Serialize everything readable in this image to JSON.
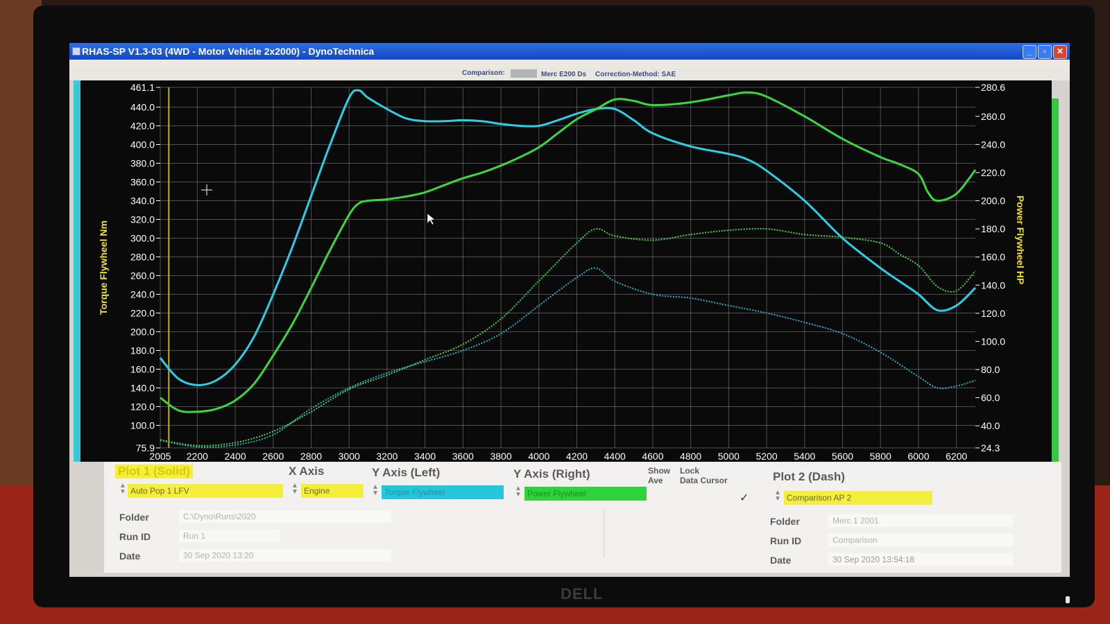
{
  "window": {
    "title": "RHAS-SP V1.3-03  (4WD - Motor Vehicle 2x2000) - DynoTechnica",
    "buttons": {
      "minimize": "_",
      "maximize": "▫",
      "close": "✕"
    }
  },
  "header": {
    "comparison_label": "Comparison:",
    "comparison_name": "Merc E200 Ds",
    "correction_method": "Correction-Method: SAE"
  },
  "chart_data": {
    "type": "line",
    "x_range": [
      2005,
      6300
    ],
    "x_ticks": [
      "2005",
      "2200",
      "2400",
      "2600",
      "2800",
      "3000",
      "3200",
      "3400",
      "3600",
      "3800",
      "4000",
      "4200",
      "4400",
      "4600",
      "4800",
      "5000",
      "5200",
      "5400",
      "5600",
      "5800",
      "6000",
      "6200"
    ],
    "y_left": {
      "label": "Torque Flywheel Nm",
      "range": [
        75.9,
        461.1
      ],
      "ticks": [
        "461.1",
        "440.0",
        "420.0",
        "400.0",
        "380.0",
        "360.0",
        "340.0",
        "320.0",
        "300.0",
        "280.0",
        "260.0",
        "240.0",
        "220.0",
        "200.0",
        "180.0",
        "160.0",
        "140.0",
        "120.0",
        "100.0",
        "75.9"
      ]
    },
    "y_right": {
      "label": "Power Flywheel HP",
      "range": [
        24.3,
        280.6
      ],
      "ticks": [
        "280.6",
        "260.0",
        "240.0",
        "220.0",
        "200.0",
        "180.0",
        "160.0",
        "140.0",
        "120.0",
        "100.0",
        "80.0",
        "60.0",
        "40.0",
        "24.3"
      ]
    },
    "grid": true,
    "series": [
      {
        "axis": "left",
        "color": "#2ad0e6",
        "style": "solid",
        "x": [
          2005,
          2100,
          2200,
          2300,
          2400,
          2500,
          2600,
          2700,
          2800,
          2900,
          3000,
          3050,
          3100,
          3200,
          3300,
          3400,
          3500,
          3600,
          3700,
          3800,
          3900,
          4000,
          4100,
          4200,
          4300,
          4400,
          4500,
          4600,
          4800,
          5000,
          5100,
          5200,
          5400,
          5600,
          5800,
          5900,
          6000,
          6100,
          6200,
          6300
        ],
        "values": [
          172,
          150,
          143,
          148,
          165,
          195,
          240,
          290,
          345,
          400,
          450,
          458,
          450,
          438,
          428,
          425,
          425,
          426,
          425,
          422,
          420,
          420,
          426,
          433,
          438,
          438,
          426,
          412,
          398,
          390,
          384,
          372,
          340,
          300,
          268,
          254,
          240,
          223,
          228,
          247
        ]
      },
      {
        "axis": "right",
        "color": "#3ad83c",
        "style": "solid",
        "x": [
          2005,
          2100,
          2200,
          2300,
          2400,
          2500,
          2600,
          2700,
          2800,
          2900,
          3000,
          3050,
          3100,
          3200,
          3300,
          3400,
          3500,
          3600,
          3700,
          3800,
          3900,
          4000,
          4100,
          4200,
          4300,
          4400,
          4500,
          4600,
          4800,
          5000,
          5100,
          5200,
          5400,
          5600,
          5800,
          5900,
          6000,
          6050,
          6100,
          6200,
          6300
        ],
        "values": [
          60,
          51,
          50,
          52,
          58,
          70,
          90,
          112,
          138,
          165,
          190,
          198,
          200,
          201,
          203,
          206,
          211,
          216,
          220,
          225,
          231,
          238,
          248,
          258,
          265,
          272,
          271,
          268,
          270,
          275,
          277,
          274,
          260,
          244,
          231,
          226,
          219,
          206,
          200,
          205,
          222
        ]
      },
      {
        "axis": "left",
        "color": "#2ab2c8",
        "style": "dotted",
        "x": [
          2005,
          2200,
          2400,
          2600,
          2800,
          3000,
          3200,
          3400,
          3600,
          3800,
          4000,
          4200,
          4300,
          4400,
          4600,
          4800,
          5000,
          5200,
          5400,
          5600,
          5800,
          6000,
          6100,
          6200,
          6300
        ],
        "values": [
          84,
          77,
          79,
          90,
          118,
          140,
          156,
          168,
          180,
          198,
          228,
          258,
          268,
          254,
          240,
          236,
          228,
          220,
          210,
          198,
          178,
          152,
          140,
          142,
          148
        ]
      },
      {
        "axis": "right",
        "color": "#4ad84a",
        "style": "dotted",
        "x": [
          2005,
          2200,
          2400,
          2600,
          2800,
          3000,
          3200,
          3400,
          3600,
          3800,
          4000,
          4200,
          4300,
          4400,
          4600,
          4800,
          5000,
          5200,
          5400,
          5600,
          5800,
          5900,
          6000,
          6100,
          6200,
          6300
        ],
        "values": [
          30,
          26,
          28,
          36,
          50,
          66,
          76,
          87,
          98,
          116,
          143,
          170,
          180,
          175,
          172,
          176,
          179,
          180,
          176,
          174,
          170,
          162,
          154,
          139,
          136,
          150
        ]
      }
    ]
  },
  "panel": {
    "plot1_label": "Plot 1 (Solid)",
    "x_axis_label": "X Axis",
    "y_left_label": "Y Axis (Left)",
    "y_right_label": "Y Axis (Right)",
    "show_label": "Show",
    "show_ave_label": "Show\nAve",
    "lock_cursor_label": "Lock\nData Cursor",
    "plot2_label": "Plot 2 (Dash)",
    "plot1_select": "Auto Pop 1 LFV",
    "x_select": "Engine",
    "y_left_select": "Torque Flywheel",
    "y_right_select": "Power Flywheel",
    "plot2_select": "Comparison AP 2",
    "folder_label": "Folder",
    "run_id_label": "Run ID",
    "date_label": "Date",
    "left_folder": "C:\\Dyno\\Runs\\2020",
    "left_run_id": "Run 1",
    "left_date": "30 Sep 2020  13:20",
    "right_folder": "Merc 1 2001",
    "right_run_id": "Comparison",
    "right_date": "30 Sep 2020  13:54:18",
    "check_mark": "✓"
  },
  "colors": {
    "plot_bg": "#0a0a0a",
    "grid": "#8a8a8a",
    "torque": "#2ad0e6",
    "power": "#3ad83c",
    "axis_label": "#f0e030",
    "yellow_select": "#f3ef3c",
    "cyan_select": "#26c6da",
    "green_select": "#2ed33c"
  },
  "device": {
    "brand": "DELL"
  }
}
